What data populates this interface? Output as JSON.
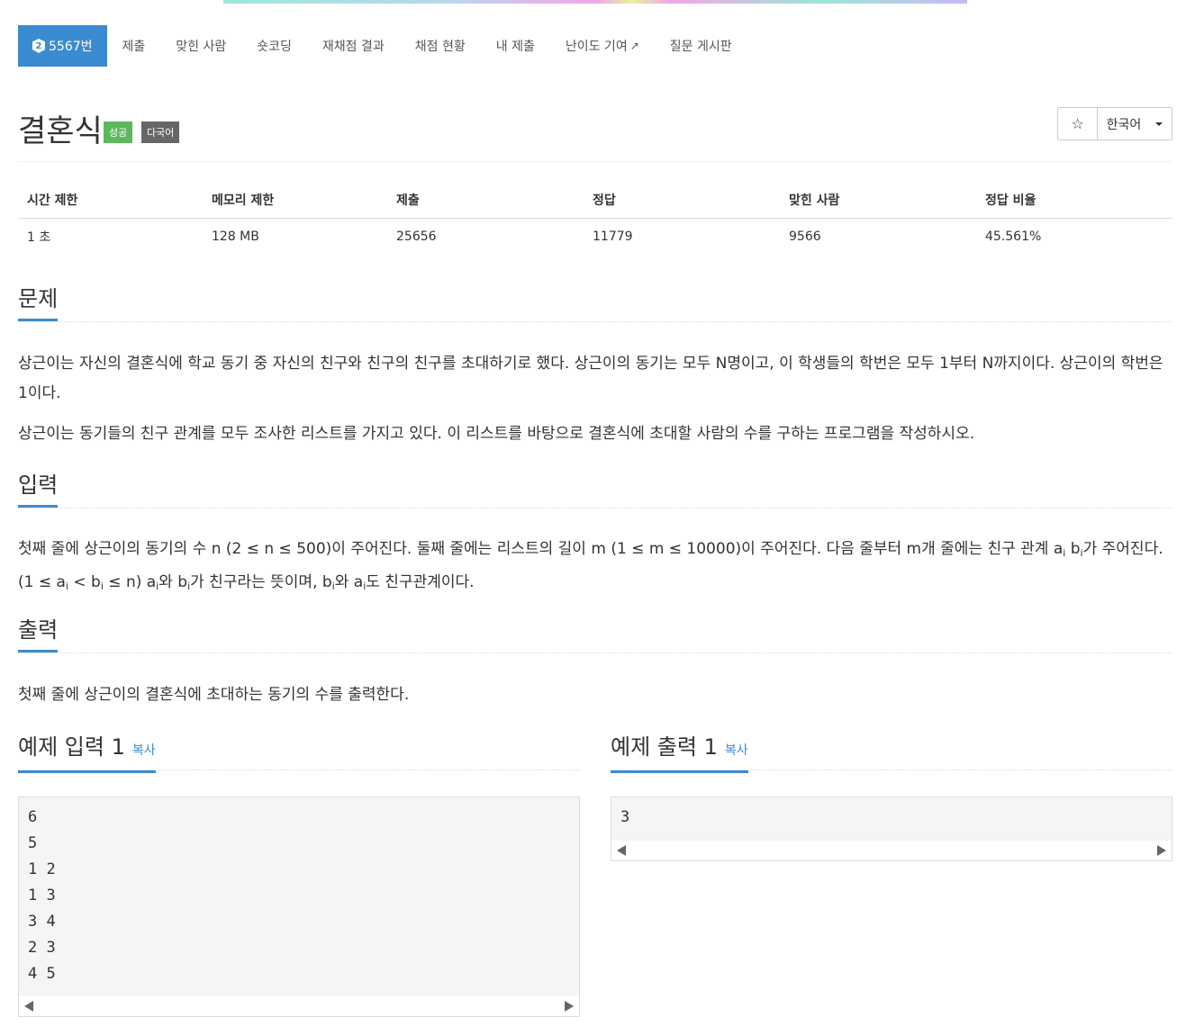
{
  "nav": {
    "problem_number": "5567번",
    "badge_icon": "level-badge-icon",
    "items": [
      "제출",
      "맞힌 사람",
      "숏코딩",
      "재채점 결과",
      "채점 현황",
      "내 제출",
      "난이도 기여",
      "질문 게시판"
    ],
    "external_link_icon": "external-link-icon"
  },
  "title": {
    "text": "결혼식",
    "tag_success": "성공",
    "tag_multi": "다국어",
    "star_icon": "star-icon",
    "language": "한국어"
  },
  "info": {
    "headers": [
      "시간 제한",
      "메모리 제한",
      "제출",
      "정답",
      "맞힌 사람",
      "정답 비율"
    ],
    "values": [
      "1 초",
      "128 MB",
      "25656",
      "11779",
      "9566",
      "45.561%"
    ]
  },
  "sections": {
    "problem": {
      "heading": "문제",
      "p1": "상근이는 자신의 결혼식에 학교 동기 중 자신의 친구와 친구의 친구를 초대하기로 했다. 상근이의 동기는 모두 N명이고, 이 학생들의 학번은 모두 1부터 N까지이다. 상근이의 학번은 1이다.",
      "p2": "상근이는 동기들의 친구 관계를 모두 조사한 리스트를 가지고 있다. 이 리스트를 바탕으로 결혼식에 초대할 사람의 수를 구하는 프로그램을 작성하시오."
    },
    "input": {
      "heading": "입력",
      "t1": "첫째 줄에 상근이의 동기의 수 n (2 ≤ n ≤ 500)이 주어진다. 둘째 줄에는 리스트의 길이 m (1 ≤ m ≤ 10000)이 주어진다. 다음 줄부터 m개 줄에는 친구 관계 a",
      "t2": " b",
      "t3": "가 주어진다. (1 ≤ a",
      "t4": " < b",
      "t5": " ≤ n) a",
      "t6": "와 b",
      "t7": "가 친구라는 뜻이며, b",
      "t8": "와 a",
      "t9": "도 친구관계이다.",
      "sub": "i"
    },
    "output": {
      "heading": "출력",
      "p1": "첫째 줄에 상근이의 결혼식에 초대하는 동기의 수를 출력한다."
    },
    "sample_input": {
      "heading": "예제 입력 1",
      "copy": "복사",
      "lines": [
        "6",
        "5",
        "1 2",
        "1 3",
        "3 4",
        "2 3",
        "4 5"
      ]
    },
    "sample_output": {
      "heading": "예제 출력 1",
      "copy": "복사",
      "lines": [
        "3"
      ]
    }
  }
}
